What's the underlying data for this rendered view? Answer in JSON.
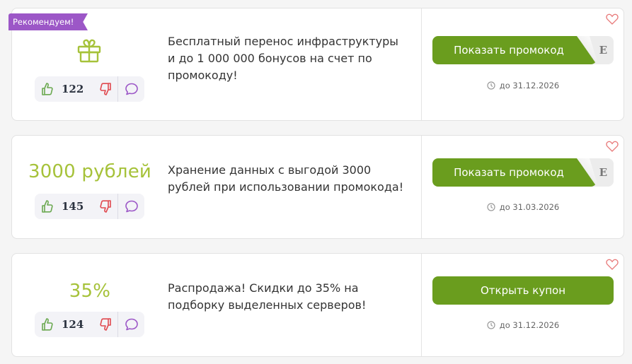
{
  "colors": {
    "accent_green": "#6a9d1e",
    "value_green": "#a6c23a",
    "ribbon_purple": "#9c57c7",
    "dislike_red": "#e0484e",
    "like_green": "#6aa84f"
  },
  "offers": [
    {
      "ribbon": "Рекомендуем!",
      "icon": "gift-icon",
      "value": "",
      "votes": "122",
      "description": "Бесплатный перенос инфраструктуры и до 1 000 000 бонусов на счет по промокоду!",
      "button": "Показать промокод",
      "code_peek": "E",
      "expiry": "до 31.12.2026"
    },
    {
      "value": "3000 рублей",
      "votes": "145",
      "description": "Хранение данных с выгодой 3000 рублей при использовании промокода!",
      "button": "Показать промокод",
      "code_peek": "E",
      "expiry": "до 31.03.2026"
    },
    {
      "value": "35%",
      "votes": "124",
      "description": "Распродажа! Скидки до 35% на подборку выделенных серверов!",
      "button": "Открыть купон",
      "expiry": "до 31.12.2026"
    }
  ]
}
